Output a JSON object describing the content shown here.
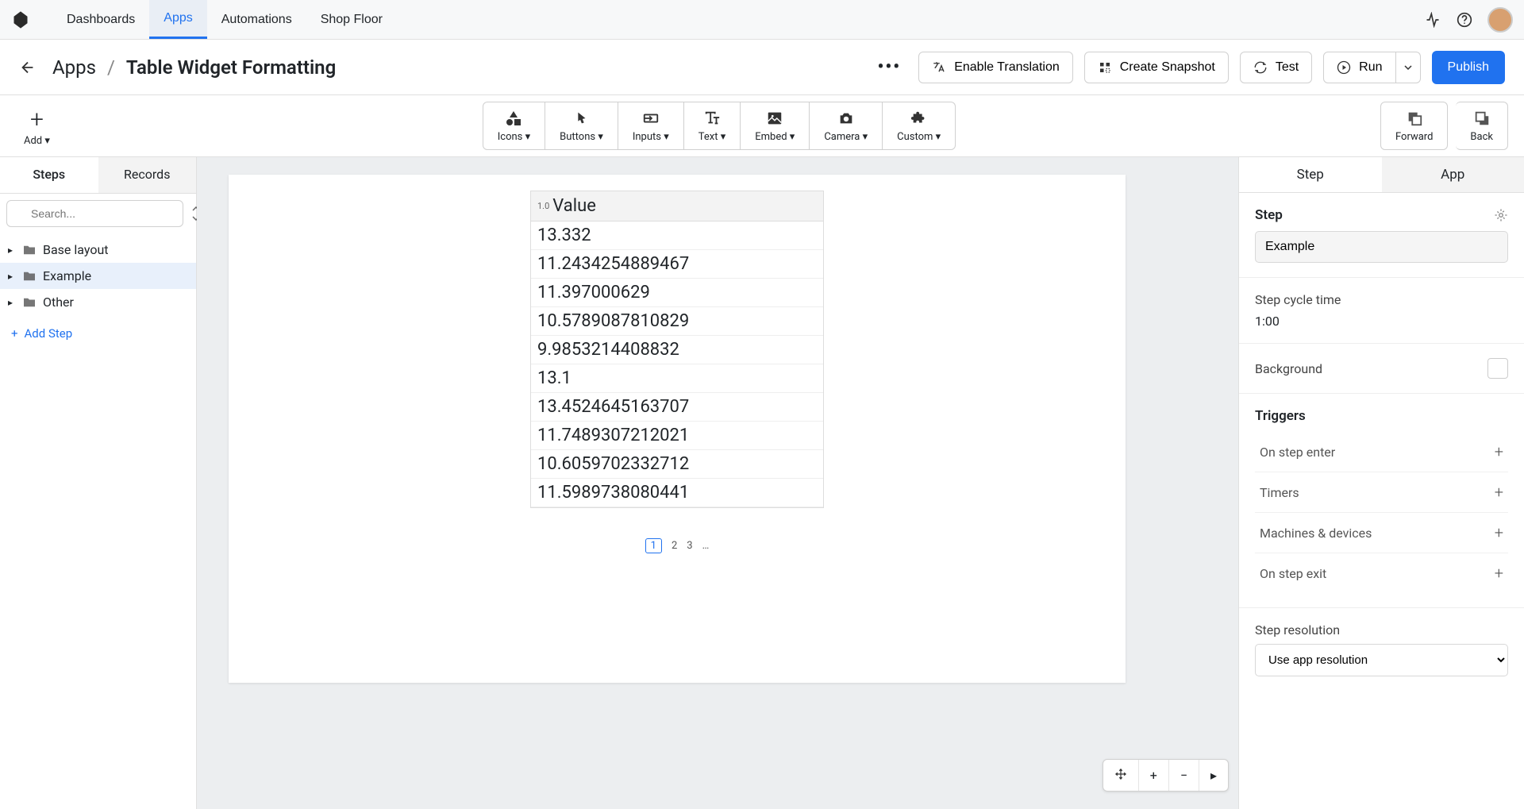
{
  "topnav": {
    "tabs": [
      "Dashboards",
      "Apps",
      "Automations",
      "Shop Floor"
    ],
    "active_tab": "Apps"
  },
  "secbar": {
    "breadcrumb_root": "Apps",
    "breadcrumb_title": "Table Widget Formatting",
    "enable_translation": "Enable Translation",
    "create_snapshot": "Create Snapshot",
    "test": "Test",
    "run": "Run",
    "publish": "Publish"
  },
  "toolbar": {
    "add": "Add",
    "icons": "Icons",
    "buttons": "Buttons",
    "inputs": "Inputs",
    "text": "Text",
    "embed": "Embed",
    "camera": "Camera",
    "custom": "Custom",
    "forward": "Forward",
    "back": "Back"
  },
  "left_panel": {
    "tabs": [
      "Steps",
      "Records"
    ],
    "search_placeholder": "Search...",
    "tree": [
      {
        "label": "Base layout",
        "icon": "folder",
        "selected": false
      },
      {
        "label": "Example",
        "icon": "folder",
        "selected": true
      },
      {
        "label": "Other",
        "icon": "folder",
        "selected": false
      }
    ],
    "add_step": "Add Step"
  },
  "table_widget": {
    "column_index": "1.0",
    "column_label": "Value",
    "rows": [
      "13.332",
      "11.2434254889467",
      "11.397000629",
      "10.5789087810829",
      "9.9853214408832",
      "13.1",
      "13.4524645163707",
      "11.7489307212021",
      "10.6059702332712",
      "11.5989738080441"
    ],
    "pages": [
      "1",
      "2",
      "3",
      "…"
    ],
    "current_page": "1"
  },
  "right_panel": {
    "tabs": [
      "Step",
      "App"
    ],
    "step_label": "Step",
    "step_name_value": "Example",
    "cycle_time_label": "Step cycle time",
    "cycle_time_value": "1:00",
    "background_label": "Background",
    "triggers_label": "Triggers",
    "triggers": [
      "On step enter",
      "Timers",
      "Machines & devices",
      "On step exit"
    ],
    "resolution_label": "Step resolution",
    "resolution_value": "Use app resolution"
  }
}
